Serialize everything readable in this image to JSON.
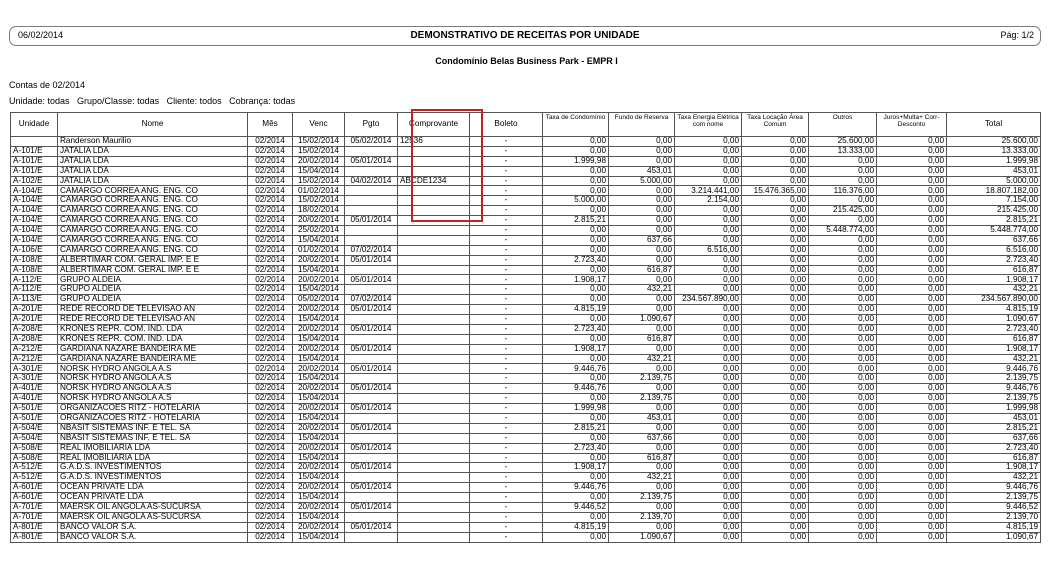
{
  "header": {
    "date": "06/02/2014",
    "title": "DEMONSTRATIVO DE RECEITAS POR UNIDADE",
    "page": "Pág: 1/2"
  },
  "subtitle": "Condomínio Belas Business Park - EMPR I",
  "contas": "Contas de 02/2014",
  "filters": "Unidade: todas   Grupo/Classe: todas   Cliente: todos   Cobrança: todas",
  "columns": [
    "Unidade",
    "Nome",
    "Mês",
    "Venc",
    "Pgto",
    "Comprovante",
    "Boleto",
    "Taxa de Condomínio",
    "Fundo de Reserva",
    "Taxa Energia Elétrica com nome",
    "Taxa Locação Área Comum",
    "Outros",
    "Juros+Multa+ Corr-Desconto",
    "Total"
  ],
  "rows": [
    [
      "",
      "Randerson Maurilio",
      "02/2014",
      "15/02/2014",
      "05/02/2014",
      "12536",
      "-",
      "0,00",
      "0,00",
      "0,00",
      "0,00",
      "25.600,00",
      "0,00",
      "25.600,00"
    ],
    [
      "A-101/E",
      "JATALIA LDA",
      "02/2014",
      "15/02/2014",
      "",
      "",
      "-",
      "0,00",
      "0,00",
      "0,00",
      "0,00",
      "13.333,00",
      "0,00",
      "13.333,00"
    ],
    [
      "A-101/E",
      "JATALIA LDA",
      "02/2014",
      "20/02/2014",
      "05/01/2014",
      "",
      "-",
      "1.999,98",
      "0,00",
      "0,00",
      "0,00",
      "0,00",
      "0,00",
      "1.999,98"
    ],
    [
      "A-101/E",
      "JATALIA LDA",
      "02/2014",
      "15/04/2014",
      "",
      "",
      "-",
      "0,00",
      "453,01",
      "0,00",
      "0,00",
      "0,00",
      "0,00",
      "453,01"
    ],
    [
      "A-102/E",
      "JATALIA LDA",
      "02/2014",
      "15/02/2014",
      "04/02/2014",
      "ABCDE1234",
      "-",
      "0,00",
      "5.000,00",
      "0,00",
      "0,00",
      "0,00",
      "0,00",
      "5.000,00"
    ],
    [
      "A-104/E",
      "CAMARGO CORREA ANG. ENG. CO",
      "02/2014",
      "01/02/2014",
      "",
      "",
      "-",
      "0,00",
      "0,00",
      "3.214.441,00",
      "15.476.365,00",
      "116.376,00",
      "0,00",
      "18.807.182,00"
    ],
    [
      "A-104/E",
      "CAMARGO CORREA ANG. ENG. CO",
      "02/2014",
      "15/02/2014",
      "",
      "",
      "-",
      "5.000,00",
      "0,00",
      "2.154,00",
      "0,00",
      "0,00",
      "0,00",
      "7.154,00"
    ],
    [
      "A-104/E",
      "CAMARGO CORREA ANG. ENG. CO",
      "02/2014",
      "18/02/2014",
      "",
      "",
      "-",
      "0,00",
      "0,00",
      "0,00",
      "0,00",
      "215.425,00",
      "0,00",
      "215.425,00"
    ],
    [
      "A-104/E",
      "CAMARGO CORREA ANG. ENG. CO",
      "02/2014",
      "20/02/2014",
      "05/01/2014",
      "",
      "-",
      "2.815,21",
      "0,00",
      "0,00",
      "0,00",
      "0,00",
      "0,00",
      "2.815,21"
    ],
    [
      "A-104/E",
      "CAMARGO CORREA ANG. ENG. CO",
      "02/2014",
      "25/02/2014",
      "",
      "",
      "-",
      "0,00",
      "0,00",
      "0,00",
      "0,00",
      "5.448.774,00",
      "0,00",
      "5.448.774,00"
    ],
    [
      "A-104/E",
      "CAMARGO CORREA ANG. ENG. CO",
      "02/2014",
      "15/04/2014",
      "",
      "",
      "-",
      "0,00",
      "637,66",
      "0,00",
      "0,00",
      "0,00",
      "0,00",
      "637,66"
    ],
    [
      "A-106/E",
      "CAMARGO CORREA ANG. ENG. CO",
      "02/2014",
      "01/02/2014",
      "07/02/2014",
      "",
      "-",
      "0,00",
      "0,00",
      "6.516,00",
      "0,00",
      "0,00",
      "0,00",
      "6.516,00"
    ],
    [
      "A-108/E",
      "ALBERTIMAR COM. GERAL IMP. E E",
      "02/2014",
      "20/02/2014",
      "05/01/2014",
      "",
      "-",
      "2.723,40",
      "0,00",
      "0,00",
      "0,00",
      "0,00",
      "0,00",
      "2.723,40"
    ],
    [
      "A-108/E",
      "ALBERTIMAR COM. GERAL IMP. E E",
      "02/2014",
      "15/04/2014",
      "",
      "",
      "-",
      "0,00",
      "616,87",
      "0,00",
      "0,00",
      "0,00",
      "0,00",
      "616,87"
    ],
    [
      "A-112/E",
      "GRUPO ALDEIA",
      "02/2014",
      "20/02/2014",
      "05/01/2014",
      "",
      "-",
      "1.908,17",
      "0,00",
      "0,00",
      "0,00",
      "0,00",
      "0,00",
      "1.908,17"
    ],
    [
      "A-112/E",
      "GRUPO ALDEIA",
      "02/2014",
      "15/04/2014",
      "",
      "",
      "-",
      "0,00",
      "432,21",
      "0,00",
      "0,00",
      "0,00",
      "0,00",
      "432,21"
    ],
    [
      "A-113/E",
      "GRUPO ALDEIA",
      "02/2014",
      "05/02/2014",
      "07/02/2014",
      "",
      "-",
      "0,00",
      "0,00",
      "234.567.890,00",
      "0,00",
      "0,00",
      "0,00",
      "234.567.890,00"
    ],
    [
      "A-201/E",
      "REDE RECORD DE TELEVISÃO AN",
      "02/2014",
      "20/02/2014",
      "05/01/2014",
      "",
      "-",
      "4.815,19",
      "0,00",
      "0,00",
      "0,00",
      "0,00",
      "0,00",
      "4.815,19"
    ],
    [
      "A-201/E",
      "REDE RECORD DE TELEVISÃO AN",
      "02/2014",
      "15/04/2014",
      "",
      "",
      "-",
      "0,00",
      "1.090,67",
      "0,00",
      "0,00",
      "0,00",
      "0,00",
      "1.090,67"
    ],
    [
      "A-208/E",
      "KRONES REPR. COM. IND. LDA",
      "02/2014",
      "20/02/2014",
      "05/01/2014",
      "",
      "-",
      "2.723,40",
      "0,00",
      "0,00",
      "0,00",
      "0,00",
      "0,00",
      "2.723,40"
    ],
    [
      "A-208/E",
      "KRONES REPR. COM. IND. LDA",
      "02/2014",
      "15/04/2014",
      "",
      "",
      "-",
      "0,00",
      "616,87",
      "0,00",
      "0,00",
      "0,00",
      "0,00",
      "616,87"
    ],
    [
      "A-212/E",
      "GARDIANA NAZARE BANDEIRA ME",
      "02/2014",
      "20/02/2014",
      "05/01/2014",
      "",
      "-",
      "1.908,17",
      "0,00",
      "0,00",
      "0,00",
      "0,00",
      "0,00",
      "1.908,17"
    ],
    [
      "A-212/E",
      "GARDIANA NAZARE BANDEIRA ME",
      "02/2014",
      "15/04/2014",
      "",
      "",
      "-",
      "0,00",
      "432,21",
      "0,00",
      "0,00",
      "0,00",
      "0,00",
      "432,21"
    ],
    [
      "A-301/E",
      "NORSK HYDRO ANGOLA A.S",
      "02/2014",
      "20/02/2014",
      "05/01/2014",
      "",
      "-",
      "9.446,76",
      "0,00",
      "0,00",
      "0,00",
      "0,00",
      "0,00",
      "9.446,76"
    ],
    [
      "A-301/E",
      "NORSK HYDRO ANGOLA A.S",
      "02/2014",
      "15/04/2014",
      "",
      "",
      "-",
      "0,00",
      "2.139,75",
      "0,00",
      "0,00",
      "0,00",
      "0,00",
      "2.139,75"
    ],
    [
      "A-401/E",
      "NORSK HYDRO ANGOLA A.S",
      "02/2014",
      "20/02/2014",
      "05/01/2014",
      "",
      "-",
      "9.446,76",
      "0,00",
      "0,00",
      "0,00",
      "0,00",
      "0,00",
      "9.446,76"
    ],
    [
      "A-401/E",
      "NORSK HYDRO ANGOLA A.S",
      "02/2014",
      "15/04/2014",
      "",
      "",
      "-",
      "0,00",
      "2.139,75",
      "0,00",
      "0,00",
      "0,00",
      "0,00",
      "2.139,75"
    ],
    [
      "A-501/E",
      "ORGANIZACOES RITZ - HOTELARIA",
      "02/2014",
      "20/02/2014",
      "05/01/2014",
      "",
      "-",
      "1.999,98",
      "0,00",
      "0,00",
      "0,00",
      "0,00",
      "0,00",
      "1.999,98"
    ],
    [
      "A-501/E",
      "ORGANIZACOES RITZ - HOTELARIA",
      "02/2014",
      "15/04/2014",
      "",
      "",
      "-",
      "0,00",
      "453,01",
      "0,00",
      "0,00",
      "0,00",
      "0,00",
      "453,01"
    ],
    [
      "A-504/E",
      "NBASIT SISTEMAS INF. E TEL. SA",
      "02/2014",
      "20/02/2014",
      "05/01/2014",
      "",
      "-",
      "2.815,21",
      "0,00",
      "0,00",
      "0,00",
      "0,00",
      "0,00",
      "2.815,21"
    ],
    [
      "A-504/E",
      "NBASIT SISTEMAS INF. E TEL. SA",
      "02/2014",
      "15/04/2014",
      "",
      "",
      "-",
      "0,00",
      "637,66",
      "0,00",
      "0,00",
      "0,00",
      "0,00",
      "637,66"
    ],
    [
      "A-508/E",
      "REAL IMOBILIARIA LDA",
      "02/2014",
      "20/02/2014",
      "05/01/2014",
      "",
      "-",
      "2.723,40",
      "0,00",
      "0,00",
      "0,00",
      "0,00",
      "0,00",
      "2.723,40"
    ],
    [
      "A-508/E",
      "REAL IMOBILIARIA LDA",
      "02/2014",
      "15/04/2014",
      "",
      "",
      "-",
      "0,00",
      "616,87",
      "0,00",
      "0,00",
      "0,00",
      "0,00",
      "616,87"
    ],
    [
      "A-512/E",
      "G.A.D.S. INVESTIMENTOS",
      "02/2014",
      "20/02/2014",
      "05/01/2014",
      "",
      "-",
      "1.908,17",
      "0,00",
      "0,00",
      "0,00",
      "0,00",
      "0,00",
      "1.908,17"
    ],
    [
      "A-512/E",
      "G.A.D.S. INVESTIMENTOS",
      "02/2014",
      "15/04/2014",
      "",
      "",
      "-",
      "0,00",
      "432,21",
      "0,00",
      "0,00",
      "0,00",
      "0,00",
      "432,21"
    ],
    [
      "A-601/E",
      "OCEAN PRIVATE LDA",
      "02/2014",
      "20/02/2014",
      "05/01/2014",
      "",
      "-",
      "9.446,76",
      "0,00",
      "0,00",
      "0,00",
      "0,00",
      "0,00",
      "9.446,76"
    ],
    [
      "A-601/E",
      "OCEAN PRIVATE LDA",
      "02/2014",
      "15/04/2014",
      "",
      "",
      "-",
      "0,00",
      "2.139,75",
      "0,00",
      "0,00",
      "0,00",
      "0,00",
      "2.139,75"
    ],
    [
      "A-701/E",
      "MAERSK OIL ANGOLA AS-SUCURSA",
      "02/2014",
      "20/02/2014",
      "05/01/2014",
      "",
      "-",
      "9.446,52",
      "0,00",
      "0,00",
      "0,00",
      "0,00",
      "0,00",
      "9.446,52"
    ],
    [
      "A-701/E",
      "MAERSK OIL ANGOLA AS-SUCURSA",
      "02/2014",
      "15/04/2014",
      "",
      "",
      "-",
      "0,00",
      "2.139,70",
      "0,00",
      "0,00",
      "0,00",
      "0,00",
      "2.139,70"
    ],
    [
      "A-801/E",
      "BANCO VALOR S.A.",
      "02/2014",
      "20/02/2014",
      "05/01/2014",
      "",
      "-",
      "4.815,19",
      "0,00",
      "0,00",
      "0,00",
      "0,00",
      "0,00",
      "4.815,19"
    ],
    [
      "A-801/E",
      "BANCO VALOR S.A.",
      "02/2014",
      "15/04/2014",
      "",
      "",
      "-",
      "0,00",
      "1.090,67",
      "0,00",
      "0,00",
      "0,00",
      "0,00",
      "1.090,67"
    ]
  ],
  "highlight_color": "#c42323"
}
